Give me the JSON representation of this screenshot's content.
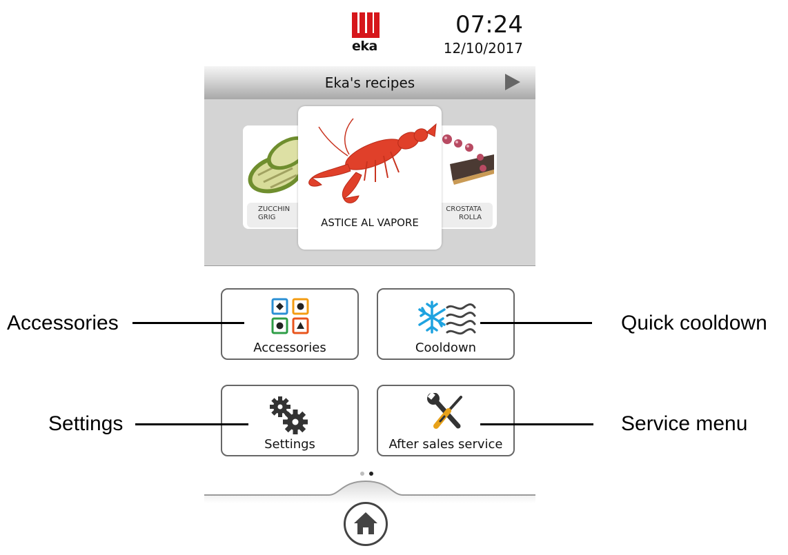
{
  "header": {
    "brand": "eka",
    "time": "07:24",
    "date": "12/10/2017"
  },
  "recipes": {
    "title": "Eka's recipes",
    "cards": [
      {
        "line1": "ZUCCHIN",
        "line2": "GRIG"
      },
      {
        "label": "ASTICE AL VAPORE"
      },
      {
        "line1": "CROSTATA",
        "line2": "ROLLA"
      }
    ]
  },
  "menu": {
    "accessories_label": "Accessories",
    "cooldown_label": "Cooldown",
    "settings_label": "Settings",
    "service_label": "After sales service"
  },
  "pagination": {
    "current": 2,
    "total": 2
  },
  "callouts": {
    "accessories": "Accessories",
    "quick_cooldown": "Quick cooldown",
    "settings": "Settings",
    "service_menu": "Service menu"
  },
  "colors": {
    "brand_red": "#d6161b",
    "accessory_blue": "#2a8fd4",
    "accessory_orange": "#f39c12",
    "accessory_green": "#2e9e47",
    "accessory_red": "#e8541c",
    "snowflake_blue": "#1fa3e0",
    "lobster_red": "#e0402a"
  },
  "icons": {
    "logo": "eka-logo-icon",
    "next": "play-arrow-icon",
    "accessories": "accessories-grid-icon",
    "cooldown": "snowflake-wind-icon",
    "settings": "gears-icon",
    "service": "wrench-screwdriver-icon",
    "home": "home-icon"
  }
}
